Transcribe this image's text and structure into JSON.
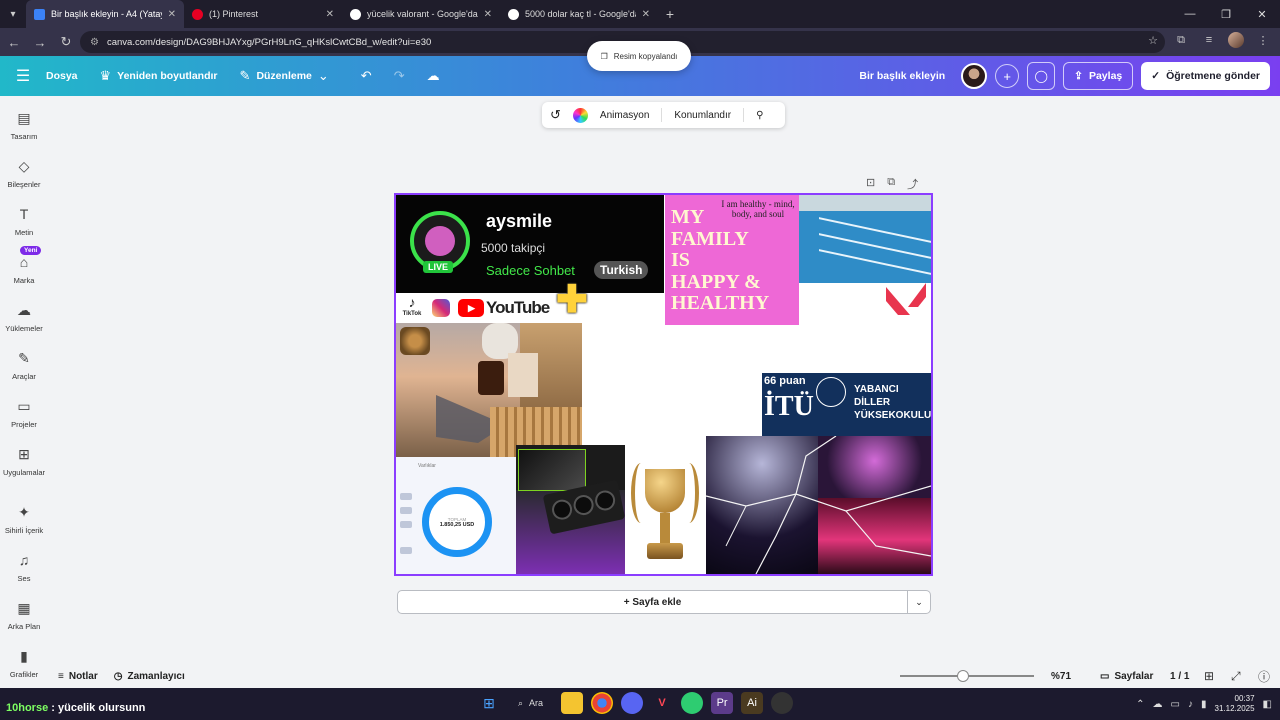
{
  "browser": {
    "tabs": [
      {
        "title": "Bir başlık ekleyin - A4 (Yatay)",
        "favicon_color": "#3b82f6",
        "active": true
      },
      {
        "title": "(1) Pinterest",
        "favicon_color": "#e60023",
        "active": false
      },
      {
        "title": "yücelik valorant - Google'da Ar",
        "favicon_color": "#ffffff",
        "active": false
      },
      {
        "title": "5000 dolar kaç tl - Google'da A",
        "favicon_color": "#ffffff",
        "active": false
      }
    ],
    "url": "canva.com/design/DAG9BHJAYxg/PGrH9LnG_qHKslCwtCBd_w/edit?ui=e30"
  },
  "toast": {
    "text": "Resim kopyalandı"
  },
  "header": {
    "file": "Dosya",
    "resize": "Yeniden boyutlandır",
    "editing": "Düzenleme",
    "doc_title": "Bir başlık ekleyin",
    "share": "Paylaş",
    "send_teacher": "Öğretmene gönder"
  },
  "sidebar": {
    "new_badge": "Yeni",
    "items": [
      {
        "label": "Tasarım",
        "icon": "layout-icon"
      },
      {
        "label": "Bileşenler",
        "icon": "elements-icon"
      },
      {
        "label": "Metin",
        "icon": "text-icon"
      },
      {
        "label": "Marka",
        "icon": "brand-icon"
      },
      {
        "label": "Yüklemeler",
        "icon": "upload-icon"
      },
      {
        "label": "Araçlar",
        "icon": "draw-icon"
      },
      {
        "label": "Projeler",
        "icon": "folder-icon"
      },
      {
        "label": "Uygulamalar",
        "icon": "apps-icon"
      },
      {
        "label": "Sihirli İçerik",
        "icon": "magic-icon"
      },
      {
        "label": "Ses",
        "icon": "music-icon"
      },
      {
        "label": "Arka Plan",
        "icon": "background-icon"
      },
      {
        "label": "Grafikler",
        "icon": "chart-icon"
      }
    ]
  },
  "context_toolbar": {
    "animate": "Animasyon",
    "position": "Konumlandır"
  },
  "canvas": {
    "live": {
      "name": "aysmile",
      "followers": "5000 takipçi",
      "badge": "LIVE",
      "mode": "Sadece Sohbet",
      "language": "Turkish"
    },
    "family": {
      "note": "I am healthy - mind, body, and soul",
      "lines": "MY FAMILY IS HAPPY & HEALTHY"
    },
    "social": {
      "tiktok": "TikTok",
      "youtube": "YouTube"
    },
    "itu": {
      "points": "66 puan",
      "logo": "İTÜ",
      "school": "YABANCI\nDİLLER\nYÜKSEKOKULU"
    },
    "finance": {
      "header": "Varlıklar",
      "label": "TOPLAM",
      "value": "1.850,25 USD"
    }
  },
  "add_page": "+ Sayfa ekle",
  "bottom_bar": {
    "notes": "Notlar",
    "timer": "Zamanlayıcı",
    "zoom_percent": 71,
    "zoom_label": "%71",
    "pages": "Sayfalar",
    "page_count": "1 / 1"
  },
  "taskbar": {
    "caption_user": "10horse",
    "caption_text": ": yücelik olursunn",
    "search": "Ara",
    "time": "00:37",
    "date": "31.12.2025"
  },
  "colors": {
    "accent": "#8b3dff",
    "live_green": "#3be24a",
    "family_pink": "#ee68d6",
    "itu_navy": "#12305c"
  }
}
